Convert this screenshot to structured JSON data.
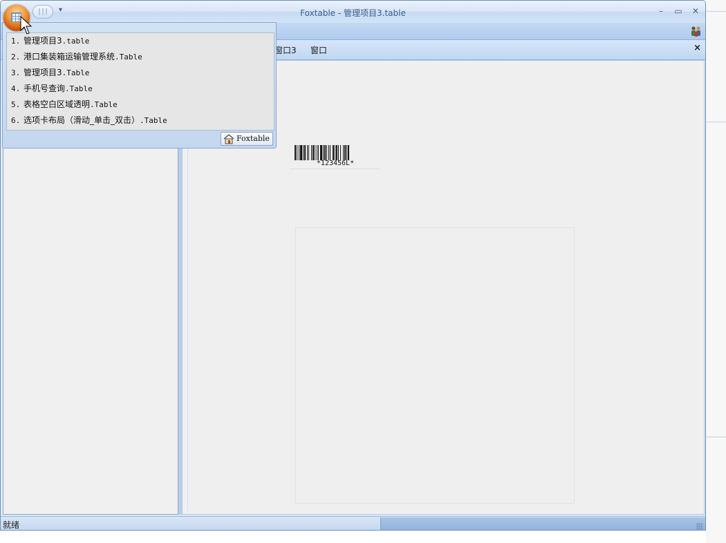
{
  "window": {
    "title": "Foxtable - 管理项目3.table",
    "qat_dropdown": "▾",
    "minimize": "–",
    "maximize": "▭",
    "close": "✕"
  },
  "tabs": [
    {
      "label": "窗口3"
    },
    {
      "label": "窗口"
    }
  ],
  "tab_close": "×",
  "recent_menu": {
    "items": [
      {
        "num": "1.",
        "name": "管理项目3",
        "ext": ".table"
      },
      {
        "num": "2.",
        "name": "港口集装箱运输管理系统",
        "ext": ".Table"
      },
      {
        "num": "3.",
        "name": "管理项目3",
        "ext": ".Table"
      },
      {
        "num": "4.",
        "name": "手机号查询",
        "ext": ".Table"
      },
      {
        "num": "5.",
        "name": "表格空白区域透明",
        "ext": ".Table"
      },
      {
        "num": "6.",
        "name": "选项卡布局（滑动_单击_双击）",
        "ext": ".Table"
      }
    ],
    "footer_button": "Foxtable"
  },
  "barcode": {
    "text": "*123456L*"
  },
  "statusbar": {
    "text": "就绪"
  },
  "icons": {
    "orb": "app-orb-icon",
    "ribbon": "users-icon",
    "footer": "home-icon"
  },
  "colors": {
    "frame": "#c3d9f3",
    "orb": "#f39a3a"
  }
}
